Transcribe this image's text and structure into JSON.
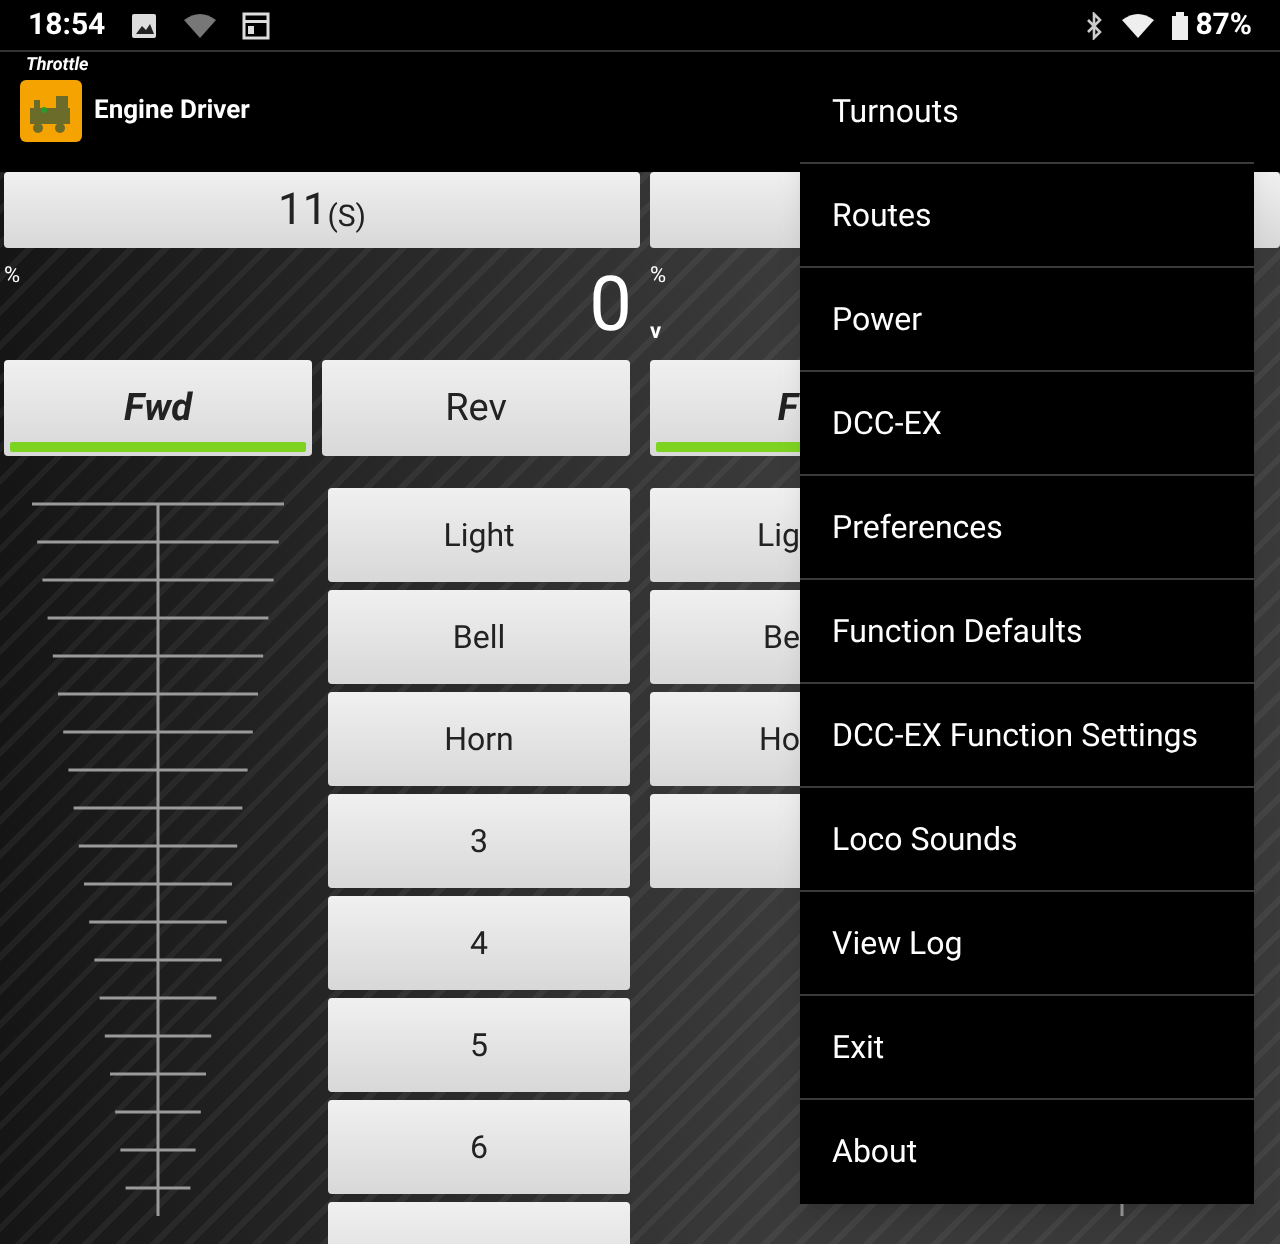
{
  "status_bar": {
    "time": "18:54",
    "battery": "87%"
  },
  "app_bar": {
    "subtitle": "Throttle",
    "title": "Engine Driver"
  },
  "throttles": [
    {
      "loco": "11",
      "loco_suffix": "(S)",
      "speed_unit": "%",
      "speed": "0",
      "directions": [
        {
          "label": "Fwd",
          "selected": true
        },
        {
          "label": "Rev",
          "selected": false
        }
      ],
      "functions": [
        "Light",
        "Bell",
        "Horn",
        "3",
        "4",
        "5",
        "6"
      ]
    },
    {
      "speed_unit": "%",
      "voltage_unit": "v",
      "directions": [
        {
          "label": "F",
          "selected": true
        }
      ],
      "functions": [
        "Lig",
        "Be",
        "Ho"
      ]
    }
  ],
  "menu": {
    "items": [
      "Turnouts",
      "Routes",
      "Power",
      "DCC-EX",
      "Preferences",
      "Function Defaults",
      "DCC-EX Function Settings",
      "Loco Sounds",
      "View Log",
      "Exit",
      "About"
    ]
  }
}
